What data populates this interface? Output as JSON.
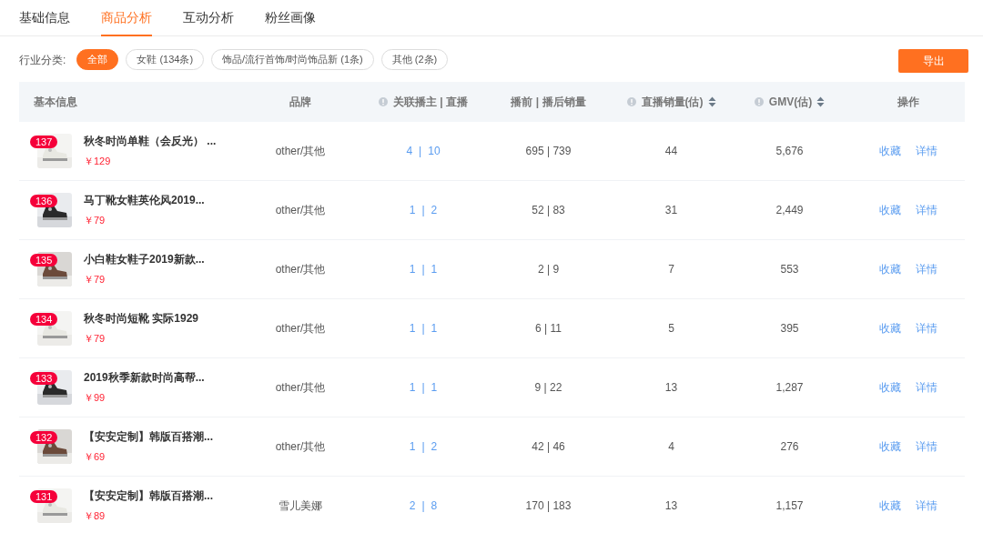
{
  "tabs": [
    {
      "label": "基础信息",
      "selected": false
    },
    {
      "label": "商品分析",
      "selected": true
    },
    {
      "label": "互动分析",
      "selected": false
    },
    {
      "label": "粉丝画像",
      "selected": false
    }
  ],
  "filter": {
    "label": "行业分类:",
    "chips": [
      {
        "label": "全部",
        "selected": true
      },
      {
        "label": "女鞋 (134条)",
        "selected": false
      },
      {
        "label": "饰品/流行首饰/时尚饰品新 (1条)",
        "selected": false
      },
      {
        "label": "其他 (2条)",
        "selected": false
      }
    ]
  },
  "export_button": "导出",
  "table": {
    "columns": [
      {
        "label": "基本信息",
        "info": false,
        "sortable": false
      },
      {
        "label": "品牌",
        "info": false,
        "sortable": false
      },
      {
        "label": "关联播主 | 直播",
        "info": true,
        "sortable": false
      },
      {
        "label": "播前 | 播后销量",
        "info": false,
        "sortable": false
      },
      {
        "label": "直播销量(估)",
        "info": true,
        "sortable": true
      },
      {
        "label": "GMV(估)",
        "info": true,
        "sortable": true
      },
      {
        "label": "操作",
        "info": false,
        "sortable": false
      }
    ],
    "rows": [
      {
        "rank": "137",
        "title": "秋冬时尚单鞋（会反光） ...",
        "price": "￥129",
        "brand": "other/其他",
        "anchors": "4",
        "separator": "|",
        "lives": "10",
        "sales": "695 | 739",
        "live_sales": "44",
        "gmv": "5,676",
        "actions": [
          "收藏",
          "详情"
        ]
      },
      {
        "rank": "136",
        "title": "马丁靴女鞋英伦风2019...",
        "price": "￥79",
        "brand": "other/其他",
        "anchors": "1",
        "separator": "|",
        "lives": "2",
        "sales": "52 | 83",
        "live_sales": "31",
        "gmv": "2,449",
        "actions": [
          "收藏",
          "详情"
        ]
      },
      {
        "rank": "135",
        "title": "小白鞋女鞋子2019新款...",
        "price": "￥79",
        "brand": "other/其他",
        "anchors": "1",
        "separator": "|",
        "lives": "1",
        "sales": "2 | 9",
        "live_sales": "7",
        "gmv": "553",
        "actions": [
          "收藏",
          "详情"
        ]
      },
      {
        "rank": "134",
        "title": "秋冬时尚短靴 实际1929",
        "price": "￥79",
        "brand": "other/其他",
        "anchors": "1",
        "separator": "|",
        "lives": "1",
        "sales": "6 | 11",
        "live_sales": "5",
        "gmv": "395",
        "actions": [
          "收藏",
          "详情"
        ]
      },
      {
        "rank": "133",
        "title": "2019秋季新款时尚高帮...",
        "price": "￥99",
        "brand": "other/其他",
        "anchors": "1",
        "separator": "|",
        "lives": "1",
        "sales": "9 | 22",
        "live_sales": "13",
        "gmv": "1,287",
        "actions": [
          "收藏",
          "详情"
        ]
      },
      {
        "rank": "132",
        "title": "【安安定制】韩版百搭潮...",
        "price": "￥69",
        "brand": "other/其他",
        "anchors": "1",
        "separator": "|",
        "lives": "2",
        "sales": "42 | 46",
        "live_sales": "4",
        "gmv": "276",
        "actions": [
          "收藏",
          "详情"
        ]
      },
      {
        "rank": "131",
        "title": "【安安定制】韩版百搭潮...",
        "price": "￥89",
        "brand": "雪儿美娜",
        "anchors": "2",
        "separator": "|",
        "lives": "8",
        "sales": "170 | 183",
        "live_sales": "13",
        "gmv": "1,157",
        "actions": [
          "收藏",
          "详情"
        ]
      }
    ]
  }
}
